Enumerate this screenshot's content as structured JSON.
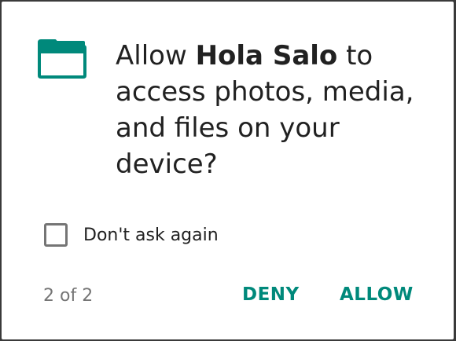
{
  "dialog": {
    "message_prefix": "Allow ",
    "app_name": "Hola Salo",
    "message_suffix": " to access photos, media, and files on your device?",
    "checkbox_label": "Don't ask again",
    "checkbox_checked": false,
    "page_counter": "2 of 2",
    "deny_label": "DENY",
    "allow_label": "ALLOW"
  },
  "icons": {
    "permission_icon": "folder-icon"
  },
  "colors": {
    "accent": "#00897b",
    "dialog_background": "#ffffff",
    "text_primary": "#212121",
    "text_secondary": "#757575"
  }
}
